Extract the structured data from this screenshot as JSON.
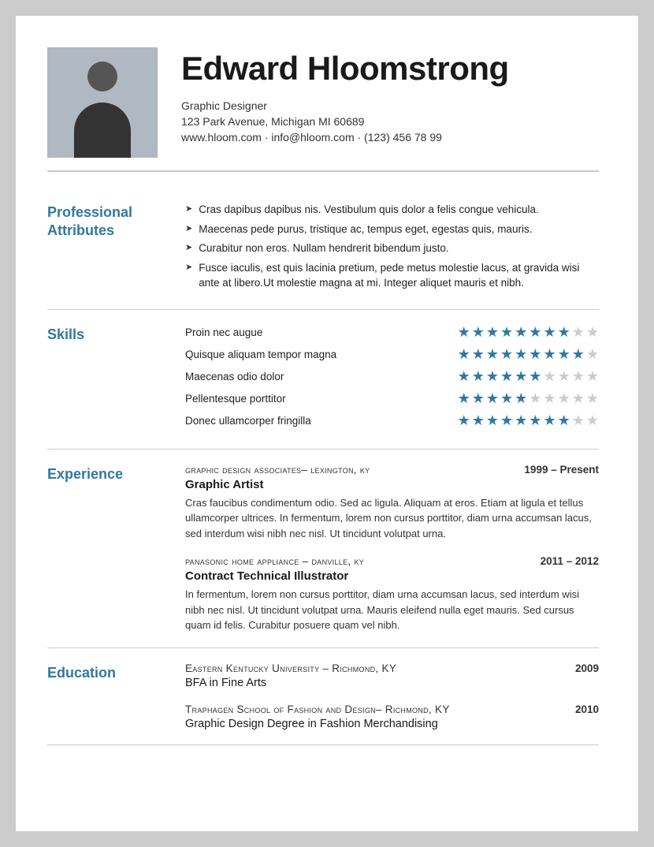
{
  "header": {
    "name": "Edward Hloomstrong",
    "title": "Graphic Designer",
    "address": "123 Park Avenue, Michigan MI 60689",
    "contact": "www.hloom.com · info@hloom.com · (123) 456 78 99"
  },
  "sections": {
    "professional": {
      "label": "Professional\nAttributes",
      "attributes": [
        "Cras dapibus dapibus nis. Vestibulum quis dolor a felis congue vehicula.",
        "Maecenas pede purus, tristique ac, tempus eget, egestas quis, mauris.",
        "Curabitur non eros. Nullam hendrerit bibendum justo.",
        "Fusce iaculis, est quis lacinia pretium, pede metus molestie lacus, at gravida wisi ante at libero.Ut molestie magna at mi. Integer aliquet mauris et nibh."
      ]
    },
    "skills": {
      "label": "Skills",
      "items": [
        {
          "name": "Proin nec augue",
          "filled": 8,
          "empty": 2
        },
        {
          "name": "Quisque aliquam tempor magna",
          "filled": 9,
          "empty": 1
        },
        {
          "name": "Maecenas odio dolor",
          "filled": 6,
          "empty": 4
        },
        {
          "name": "Pellentesque porttitor",
          "filled": 5,
          "empty": 5
        },
        {
          "name": "Donec ullamcorper fringilla",
          "filled": 8,
          "empty": 2
        }
      ]
    },
    "experience": {
      "label": "Experience",
      "entries": [
        {
          "company": "Graphic Design Associates–",
          "company_suffix": " Lexington, KY",
          "date": "1999 – Present",
          "title": "Graphic Artist",
          "desc": "Cras faucibus condimentum odio. Sed ac ligula. Aliquam at eros. Etiam at ligula et tellus ullamcorper ultrices. In fermentum, lorem non cursus porttitor, diam urna accumsan lacus, sed interdum wisi nibh nec nisl. Ut tincidunt volutpat urna."
        },
        {
          "company": "Panasonic Home Appliance",
          "company_suffix": " – Danville, KY",
          "date": "2011 – 2012",
          "title": "Contract Technical Illustrator",
          "desc": "In fermentum, lorem non cursus porttitor, diam urna accumsan lacus, sed interdum wisi nibh nec nisl. Ut tincidunt volutpat urna. Mauris eleifend nulla eget mauris. Sed cursus quam id felis. Curabitur posuere quam vel nibh."
        }
      ]
    },
    "education": {
      "label": "Education",
      "entries": [
        {
          "school": "Eastern Kentucky University",
          "school_suffix": " – Richmond, KY",
          "year": "2009",
          "degree": "BFA in Fine Arts"
        },
        {
          "school": "Traphagen School of Fashion and Design",
          "school_suffix": "– Richmond, KY",
          "year": "2010",
          "degree": "Graphic Design Degree in Fashion Merchandising"
        }
      ]
    }
  }
}
